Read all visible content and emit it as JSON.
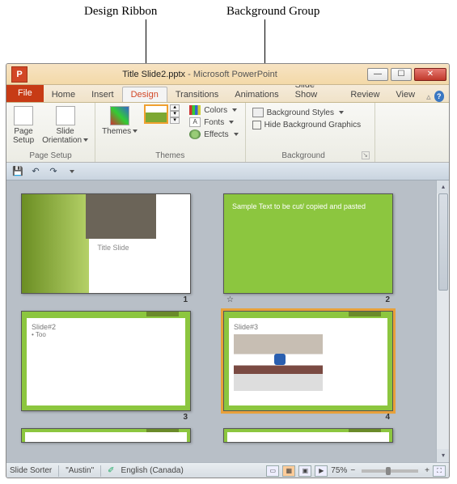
{
  "annotations": {
    "design_ribbon": "Design Ribbon",
    "background_group": "Background Group"
  },
  "window": {
    "app_letter": "P",
    "filename": "Title Slide2.pptx",
    "app_name": "Microsoft PowerPoint"
  },
  "tabs": {
    "file": "File",
    "items": [
      "Home",
      "Insert",
      "Design",
      "Transitions",
      "Animations",
      "Slide Show",
      "Review",
      "View"
    ],
    "active_index": 2
  },
  "ribbon": {
    "page_setup": {
      "label": "Page Setup",
      "page_setup_btn": "Page\nSetup",
      "orientation_btn": "Slide\nOrientation"
    },
    "themes": {
      "label": "Themes",
      "themes_btn": "Themes",
      "colors": "Colors",
      "fonts": "Fonts",
      "effects": "Effects"
    },
    "background": {
      "label": "Background",
      "styles": "Background Styles",
      "hide": "Hide Background Graphics"
    }
  },
  "slides": [
    {
      "num": "1",
      "title": "Title Slide",
      "star": ""
    },
    {
      "num": "2",
      "text": "Sample Text to be cut/ copied and pasted",
      "star": "☆"
    },
    {
      "num": "3",
      "title": "Slide#2",
      "bullet": "Too",
      "star": ""
    },
    {
      "num": "4",
      "title": "Slide#3",
      "star": ""
    }
  ],
  "status": {
    "view": "Slide Sorter",
    "theme": "\"Austin\"",
    "lang": "English (Canada)",
    "zoom": "75%"
  }
}
